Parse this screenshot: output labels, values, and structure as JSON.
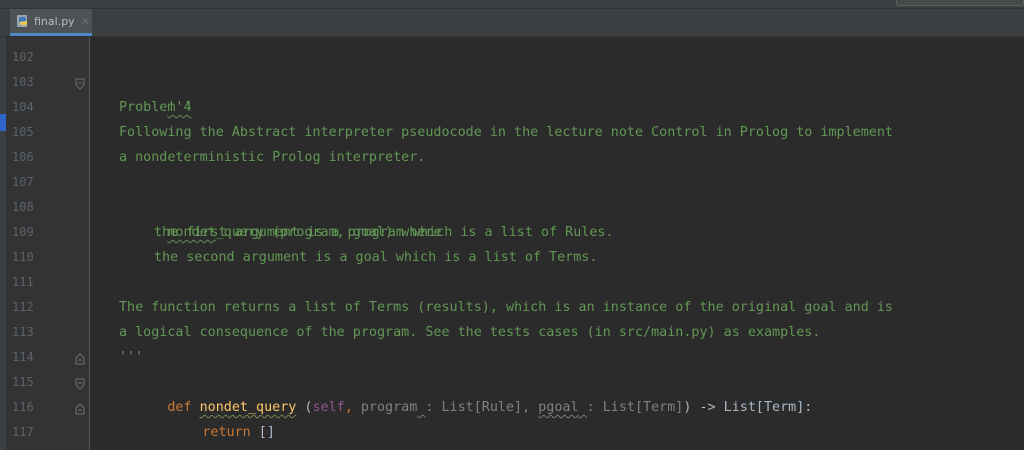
{
  "tab": {
    "label": "final.py",
    "close": "✕"
  },
  "gutter": {
    "lines": [
      "102",
      "103",
      "104",
      "105",
      "106",
      "107",
      "108",
      "109",
      "110",
      "111",
      "112",
      "113",
      "114",
      "115",
      "116",
      "117"
    ]
  },
  "code": {
    "l103": "'''",
    "l104": "Problem 4",
    "l105": "Following the Abstract interpreter pseudocode in the lecture note Control in Prolog to implement",
    "l106": "a nondeterministic Prolog interpreter.",
    "l108_name": "nondet",
    "l108_rest": "_query (program, goal) where",
    "l109": "the first argument is a program which is a list of Rules.",
    "l110": "the second argument is a goal which is a list of Terms.",
    "l112": "The function returns a list of Terms (results), which is an instance of the original goal and is",
    "l113": "a logical consequence of the program. See the tests cases (in src/main.py) as examples.",
    "l114": "'''",
    "l115_def": "def ",
    "l115_fn": "nondet_query",
    "l115_sp": " (",
    "l115_self": "self",
    "l115_comma1": ", ",
    "l115_p1": "program",
    "l115_sp1": " ",
    "l115_t1": ": List[Rule], ",
    "l115_p2": "pgoal",
    "l115_sp2": " ",
    "l115_t2": ": List[Term]",
    "l115_ret": ") -> List[Term]:",
    "l116_return": "return",
    "l116_val": " []"
  },
  "colors": {
    "docstring": "#629755",
    "keyword": "#cc7832",
    "function": "#ffc66d",
    "self": "#94558d",
    "text": "#a9b7c6",
    "tab_underline": "#4a88c7"
  }
}
